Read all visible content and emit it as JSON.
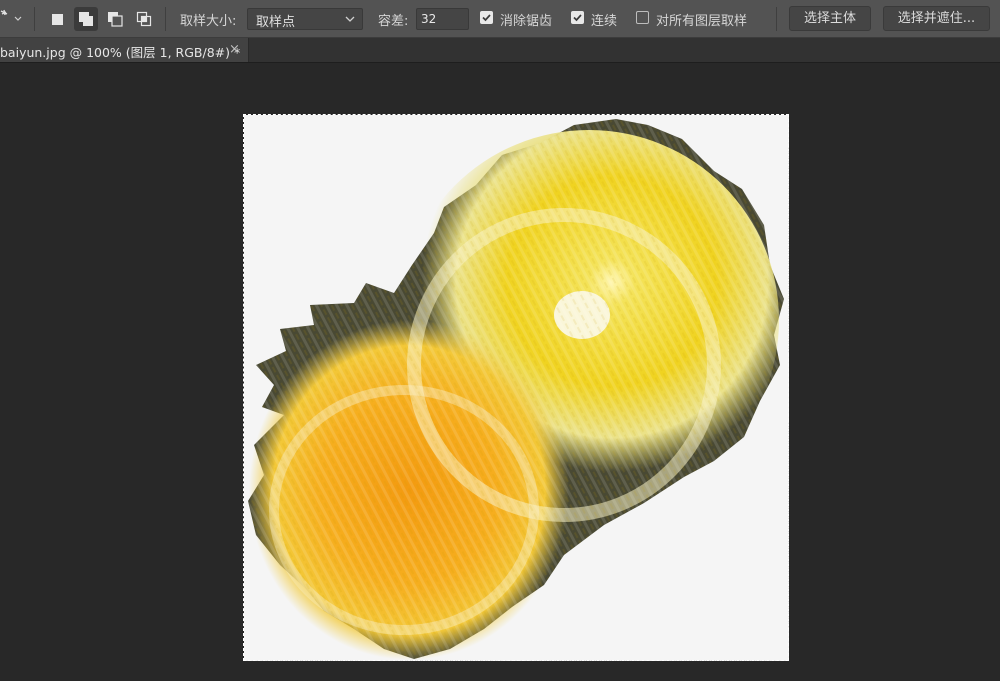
{
  "options_bar": {
    "tool_icon": "magic-wand-icon",
    "selection_modes": [
      {
        "name": "new-selection-icon",
        "active": false
      },
      {
        "name": "add-to-selection-icon",
        "active": true
      },
      {
        "name": "subtract-from-selection-icon",
        "active": false
      },
      {
        "name": "intersect-selection-icon",
        "active": false
      }
    ],
    "sample_size_label": "取样大小:",
    "sample_size_value": "取样点",
    "tolerance_label": "容差:",
    "tolerance_value": "32",
    "anti_alias_label": "消除锯齿",
    "anti_alias_checked": true,
    "contiguous_label": "连续",
    "contiguous_checked": true,
    "sample_all_layers_label": "对所有图层取样",
    "sample_all_layers_checked": false,
    "select_subject_label": "选择主体",
    "select_and_mask_label": "选择并遮住..."
  },
  "document_tab": {
    "title": "baiyun.jpg @ 100% (图层 1, RGB/8#) *",
    "close_glyph": "×"
  },
  "colors": {
    "canvas_bg": "#282828",
    "doc_bg": "#f5f5f5",
    "yellow": "#f2d41a",
    "orange": "#f5a312"
  }
}
